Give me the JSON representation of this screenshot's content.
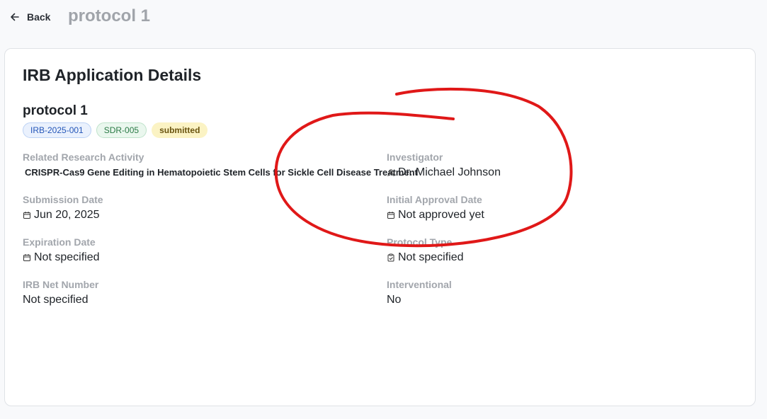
{
  "header": {
    "back_label": "Back",
    "page_title": "protocol 1"
  },
  "card": {
    "title": "IRB Application Details",
    "protocol_name": "protocol 1",
    "badges": {
      "irb": "IRB-2025-001",
      "sdr": "SDR-005",
      "status": "submitted"
    },
    "fields": {
      "related_activity": {
        "label": "Related Research Activity",
        "value": "CRISPR-Cas9 Gene Editing in Hematopoietic Stem Cells for Sickle Cell Disease Treatment"
      },
      "investigator": {
        "label": "Investigator",
        "value": "Dr. Michael Johnson",
        "icon": "user-icon"
      },
      "submission_date": {
        "label": "Submission Date",
        "value": "Jun 20, 2025",
        "icon": "calendar-icon"
      },
      "initial_approval_date": {
        "label": "Initial Approval Date",
        "value": "Not approved yet",
        "icon": "calendar-icon"
      },
      "expiration_date": {
        "label": "Expiration Date",
        "value": "Not specified",
        "icon": "calendar-icon"
      },
      "protocol_type": {
        "label": "Protocol Type",
        "value": "Not specified",
        "icon": "clipboard-icon"
      },
      "irb_net_number": {
        "label": "IRB Net Number",
        "value": "Not specified"
      },
      "interventional": {
        "label": "Interventional",
        "value": "No"
      }
    }
  },
  "colors": {
    "annotation": "#e01818",
    "badge_irb": "#2456b8",
    "badge_sdr": "#2a7a45",
    "badge_status": "#fbf3c4"
  }
}
